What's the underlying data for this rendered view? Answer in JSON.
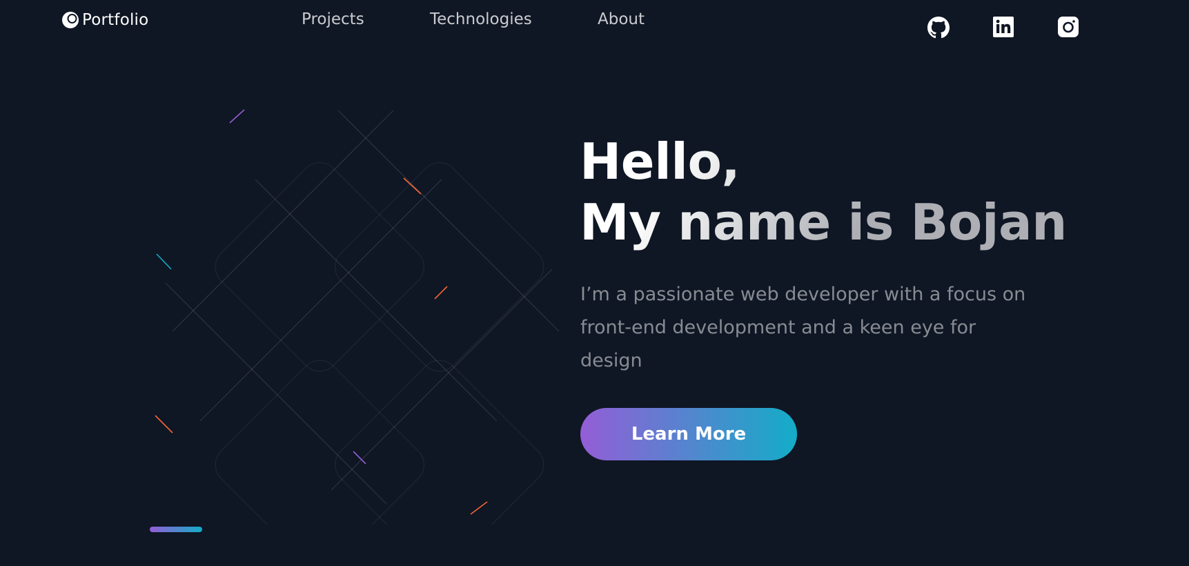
{
  "header": {
    "logo_text": "Portfolio",
    "nav": [
      {
        "label": "Projects"
      },
      {
        "label": "Technologies"
      },
      {
        "label": "About"
      }
    ],
    "social": [
      {
        "icon": "github-icon"
      },
      {
        "icon": "linkedin-icon"
      },
      {
        "icon": "instagram-icon"
      }
    ]
  },
  "hero": {
    "title_line1": "Hello,",
    "title_line2": "My name is Bojan",
    "description": "I’m a passionate web developer with a focus on front-end development and a keen eye for design",
    "cta_label": "Learn More"
  },
  "colors": {
    "background": "#0f1624",
    "gradient_start": "#945dd6",
    "gradient_mid": "#6978d1",
    "gradient_end": "#13adc7",
    "accent_orange": "#f46737"
  }
}
